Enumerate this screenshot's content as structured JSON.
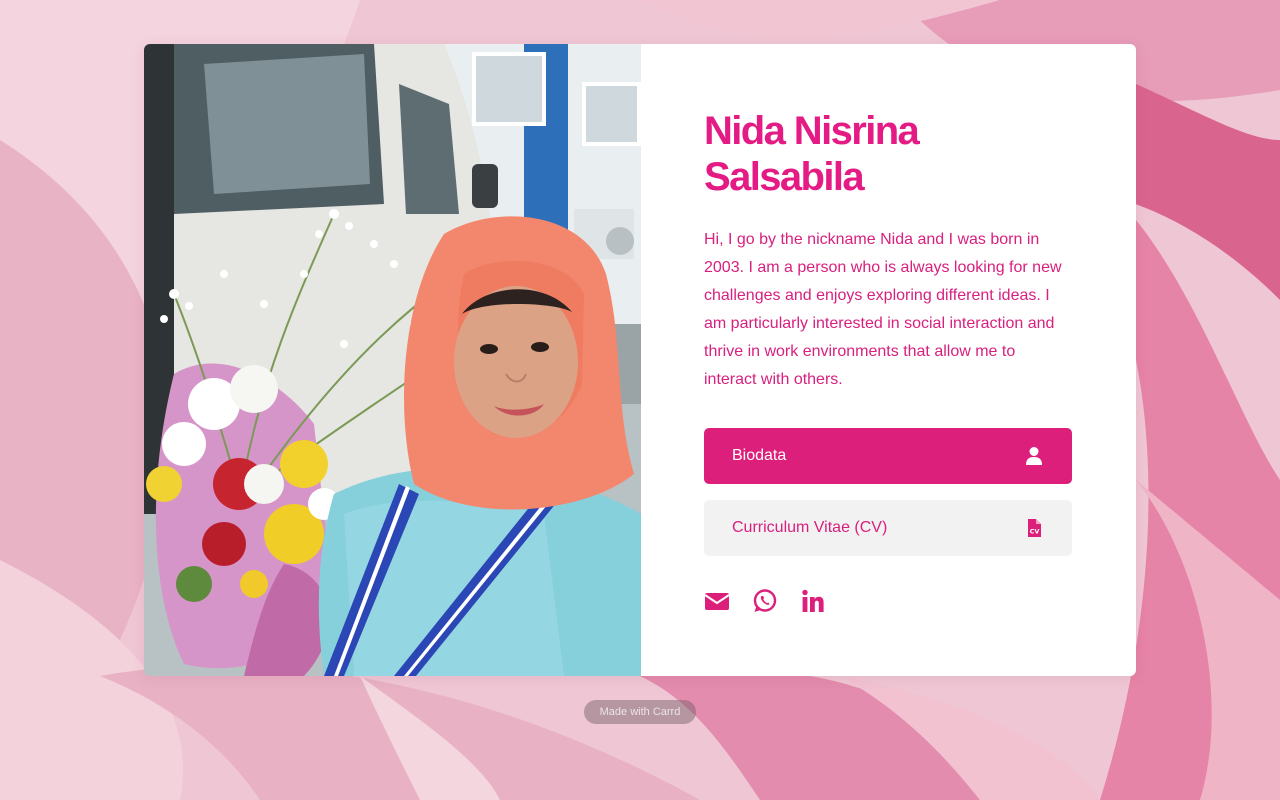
{
  "colors": {
    "accent": "#e41b84",
    "button_primary": "#dc1f7b",
    "button_secondary": "#f2f2f2",
    "card_bg": "#ffffff"
  },
  "profile": {
    "name_line1": "Nida Nisrina",
    "name_line2": "Salsabila",
    "bio": "Hi, I go by the nickname Nida and I was born in 2003. I am a person who is always looking for new challenges and enjoys exploring different ideas. I am particularly interested in social interaction and thrive in work environments that allow me to interact with others."
  },
  "buttons": {
    "biodata": {
      "label": "Biodata",
      "icon": "user-icon"
    },
    "cv": {
      "label": "Curriculum Vitae (CV)",
      "icon": "file-cv-icon"
    }
  },
  "social": [
    {
      "icon": "envelope-icon"
    },
    {
      "icon": "whatsapp-icon"
    },
    {
      "icon": "linkedin-icon"
    }
  ],
  "footer": {
    "made_with": "Made with Carrd"
  }
}
